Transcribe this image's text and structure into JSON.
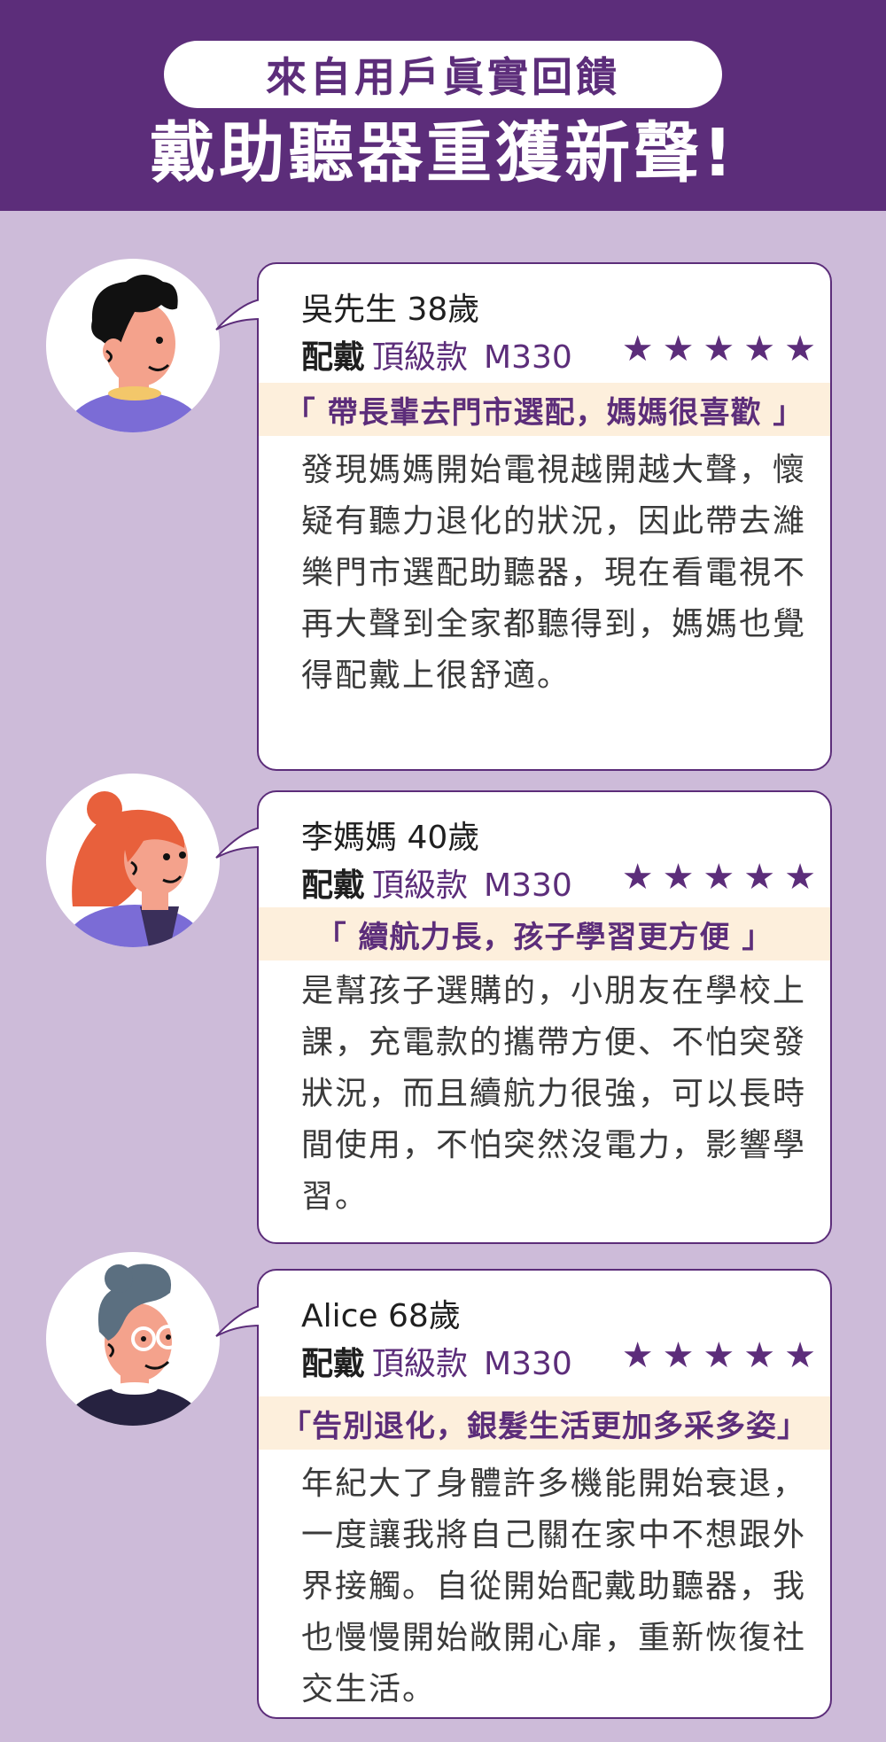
{
  "header": {
    "subtitle": "來自用戶眞實回饋",
    "title": "戴助聽器重獲新聲!"
  },
  "colors": {
    "header_bg": "#5c2d7a",
    "page_bg": "#cdbbd9",
    "quote_bg": "#fdefdc",
    "accent": "#5c2d7a"
  },
  "reviews": [
    {
      "name": "吳先生 38歲",
      "wear_label": "配戴",
      "tier": "頂級款",
      "model": "M330",
      "rating": 5,
      "quote": "「 帶長輩去門市選配，媽媽很喜歡 」",
      "body": "發現媽媽開始電視越開越大聲，懷疑有聽力退化的狀況，因此帶去濰樂門市選配助聽器，現在看電視不再大聲到全家都聽得到，媽媽也覺得配戴上很舒適。",
      "avatar_icon": "man-curly-hair-avatar-icon"
    },
    {
      "name": "李媽媽 40歲",
      "wear_label": "配戴",
      "tier": "頂級款",
      "model": "M330",
      "rating": 5,
      "quote": "「 續航力長，孩子學習更方便 」",
      "body": "是幫孩子選購的，小朋友在學校上課，充電款的攜帶方便、不怕突發狀況，而且續航力很強，可以長時間使用，不怕突然沒電力，影響學習。",
      "avatar_icon": "woman-red-hair-avatar-icon"
    },
    {
      "name": "Alice 68歲",
      "wear_label": "配戴",
      "tier": "頂級款",
      "model": "M330",
      "rating": 5,
      "quote": "「告別退化，銀髮生活更加多采多姿」",
      "body": "年紀大了身體許多機能開始衰退，一度讓我將自己關在家中不想跟外界接觸。自從開始配戴助聽器，我也慢慢開始敞開心扉，重新恢復社交生活。",
      "avatar_icon": "elderly-woman-glasses-avatar-icon"
    }
  ]
}
